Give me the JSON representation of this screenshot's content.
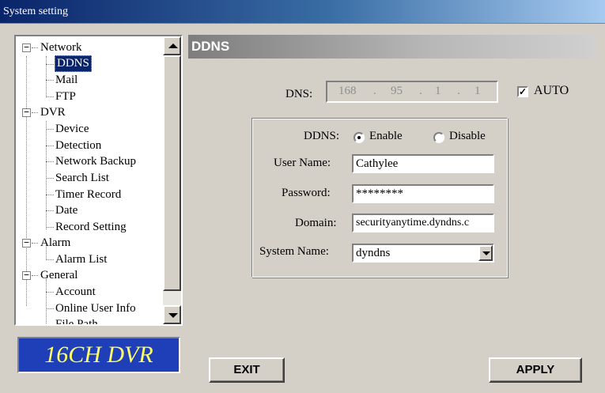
{
  "window": {
    "title": "System setting"
  },
  "tree": {
    "network": {
      "label": "Network",
      "children": [
        "DDNS",
        "Mail",
        "FTP"
      ]
    },
    "dvr": {
      "label": "DVR",
      "children": [
        "Device",
        "Detection",
        "Network Backup",
        "Search List",
        "Timer Record",
        "Date",
        "Record Setting"
      ]
    },
    "alarm": {
      "label": "Alarm",
      "children": [
        "Alarm List"
      ]
    },
    "general": {
      "label": "General",
      "children": [
        "Account",
        "Online User Info",
        "File Path"
      ]
    },
    "selected": "DDNS",
    "toggle_symbol": "−"
  },
  "logo": {
    "text": "16CH DVR"
  },
  "header": {
    "title": "DDNS"
  },
  "dns": {
    "label": "DNS:",
    "octets": [
      "168",
      "95",
      "1",
      "1"
    ],
    "separator": ".",
    "auto_label": "AUTO",
    "auto_checked": true,
    "check_mark": "✓"
  },
  "ddns_form": {
    "ddns_label": "DDNS:",
    "enable_label": "Enable",
    "disable_label": "Disable",
    "enabled": true,
    "username_label": "User Name:",
    "username_value": "Cathylee",
    "password_label": "Password:",
    "password_value": "********",
    "domain_label": "Domain:",
    "domain_value": "securityanytime.dyndns.c",
    "system_name_label": "System Name:",
    "system_name_value": "dyndns"
  },
  "buttons": {
    "exit": "EXIT",
    "apply": "APPLY"
  },
  "colors": {
    "selection": "#0a246a",
    "logo_bg": "#1f3fb8",
    "logo_text": "#ffff66"
  }
}
